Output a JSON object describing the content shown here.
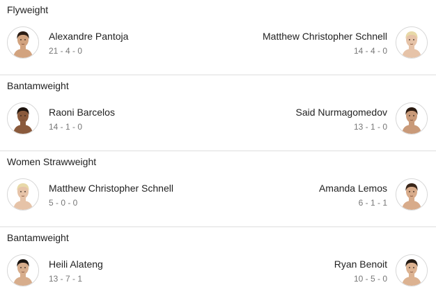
{
  "bouts": [
    {
      "weight_class": "Flyweight",
      "left": {
        "name": "Alexandre Pantoja",
        "record": "21 - 4 - 0",
        "avatar_icon": "fighter-headshot-icon",
        "skin": "#d2a37f",
        "hair": "#2b1d14"
      },
      "right": {
        "name": "Matthew Christopher Schnell",
        "record": "14 - 4 - 0",
        "avatar_icon": "fighter-headshot-icon",
        "skin": "#e6c3a8",
        "hair": "#e8d9a8"
      }
    },
    {
      "weight_class": "Bantamweight",
      "left": {
        "name": "Raoni Barcelos",
        "record": "14 - 1 - 0",
        "avatar_icon": "fighter-headshot-icon",
        "skin": "#8a5a3c",
        "hair": "#1e140e"
      },
      "right": {
        "name": "Said Nurmagomedov",
        "record": "13 - 1 - 0",
        "avatar_icon": "fighter-headshot-icon",
        "skin": "#c99a79",
        "hair": "#2a1a10"
      }
    },
    {
      "weight_class": "Women Strawweight",
      "left": {
        "name": "Matthew Christopher Schnell",
        "record": "5 - 0 - 0",
        "avatar_icon": "fighter-headshot-icon",
        "skin": "#e6c3a8",
        "hair": "#e8d9a8"
      },
      "right": {
        "name": "Amanda Lemos",
        "record": "6 - 1 - 1",
        "avatar_icon": "fighter-headshot-icon",
        "skin": "#d8ab8a",
        "hair": "#3a2619"
      }
    },
    {
      "weight_class": "Bantamweight",
      "left": {
        "name": "Heili Alateng",
        "record": "13 - 7 - 1",
        "avatar_icon": "fighter-headshot-icon",
        "skin": "#d7ad8c",
        "hair": "#1a1410"
      },
      "right": {
        "name": "Ryan Benoit",
        "record": "10 - 5 - 0",
        "avatar_icon": "fighter-headshot-icon",
        "skin": "#dcb291",
        "hair": "#231913"
      }
    }
  ]
}
